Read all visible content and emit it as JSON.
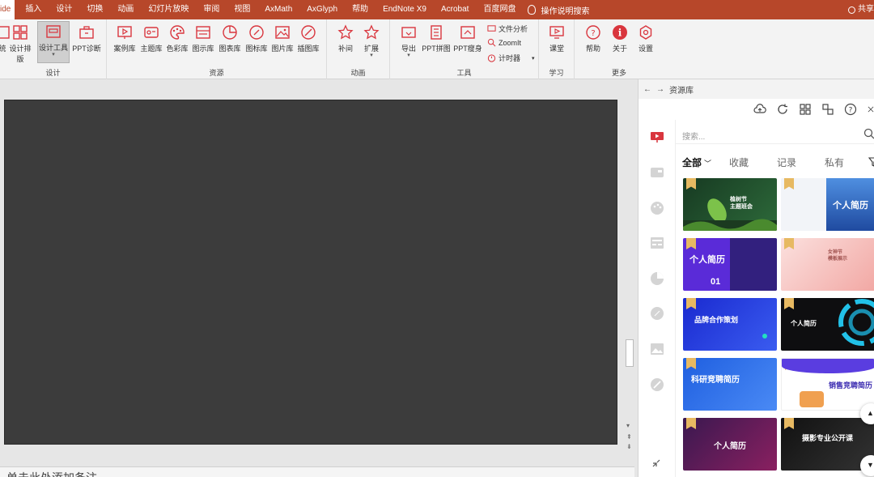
{
  "menubar": {
    "items": [
      "ide",
      "插入",
      "设计",
      "切换",
      "动画",
      "幻灯片放映",
      "审阅",
      "视图",
      "AxMath",
      "AxGlyph",
      "帮助",
      "EndNote X9",
      "Acrobat",
      "百度网盘"
    ],
    "tellme": "操作说明搜索",
    "share": "共享"
  },
  "ribbon": {
    "groups": {
      "design": "设计",
      "resources": "资源",
      "animation": "动画",
      "tools": "工具",
      "learn": "学习",
      "more": "更多"
    },
    "buttons": {
      "partial": "统",
      "layout": "设计排版",
      "design_tools": "设计工具",
      "diagnose": "PPT诊断",
      "cases": "案例库",
      "themes": "主题库",
      "colors": "色彩库",
      "charts_show": "图示库",
      "charts": "图表库",
      "icons": "图标库",
      "pictures": "图片库",
      "illustrations": "插图库",
      "tween": "补间",
      "extend": "扩展",
      "export": "导出",
      "ppt_stitch": "PPT拼图",
      "ppt_slim": "PPT瘦身",
      "file_analysis": "文件分析",
      "zoomit": "ZoomIt",
      "timer": "计时器",
      "classroom": "课堂",
      "help": "帮助",
      "about": "关于",
      "settings": "设置"
    }
  },
  "editor": {
    "notes_placeholder": "单击此处添加备注"
  },
  "pane": {
    "title": "资源库",
    "search_placeholder": "搜索...",
    "tabs": [
      "全部",
      "收藏",
      "记录",
      "私有"
    ],
    "cards": [
      {
        "title": "植树节\n主题班会",
        "bg": "#1f4a2b",
        "accent": "#6ab04c"
      },
      {
        "title": "个人简历",
        "bg": "#f2f4f8",
        "accent": "#2f5fa8"
      },
      {
        "title": "个人简历",
        "bg": "#5a2bd8",
        "accent": "#2b1e6e",
        "sub": "01"
      },
      {
        "title": "女神节\n模板展示",
        "bg": "#f6c6c4",
        "accent": "#e89a98"
      },
      {
        "title": "品牌合作策划",
        "bg": "#2034d6",
        "accent": "#3a6af0"
      },
      {
        "title": "个人简历",
        "bg": "#0e0e10",
        "accent": "#22c1e8"
      },
      {
        "title": "科研竞聘简历",
        "bg": "#1f5fe0",
        "accent": "#6aa4ff"
      },
      {
        "title": "销售竞聘简历",
        "bg": "#ffffff",
        "accent": "#5a3de0"
      },
      {
        "title": "个人简历",
        "bg": "#3a1850",
        "accent": "#c0306a"
      },
      {
        "title": "摄影专业公开课",
        "bg": "#1a1a1a",
        "accent": "#555555"
      }
    ]
  },
  "colors": {
    "brand": "#b7472a",
    "accent_red": "#d9363e",
    "slide": "#3c3c3c"
  }
}
